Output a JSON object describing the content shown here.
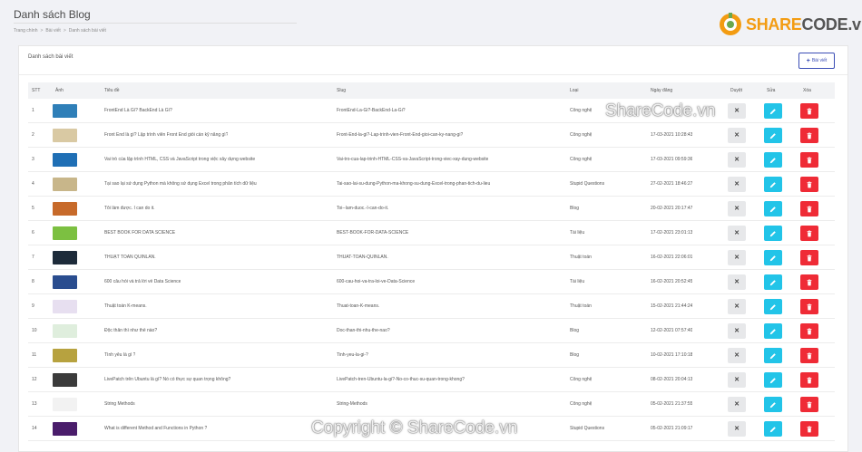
{
  "header": {
    "title": "Danh sách Blog"
  },
  "breadcrumb": [
    "Trang chính",
    "Bài viết",
    "Danh sách bài viết"
  ],
  "logo": {
    "part1": "SHARE",
    "part2": "CODE.vn"
  },
  "card": {
    "title": "Danh sách bài viết",
    "add_label": "Bài viết"
  },
  "table": {
    "headers": {
      "stt": "STT",
      "image": "Ảnh",
      "title": "Tiêu đề",
      "slug": "Slug",
      "type": "Loại",
      "date": "Ngày đăng",
      "approve": "Duyệt",
      "edit": "Sửa",
      "delete": "Xóa"
    },
    "rows": [
      {
        "stt": "1",
        "title": "FrontEnd Là Gì? BackEnd Là Gì?",
        "slug": "FrontEnd-La-Gi?-BackEnd-La-Gi?",
        "type": "Công nghệ",
        "date": "",
        "thumb": "#2f7fb8"
      },
      {
        "stt": "2",
        "title": "Front End là gì? Lập trình viên Front End giỏi cần kỹ năng gì?",
        "slug": "Front-End-la-gi?-Lap-trinh-vien-Front-End-gioi-can-ky-nang-gi?",
        "type": "Công nghệ",
        "date": "17-03-2021 10:28:43",
        "thumb": "#d9c9a3"
      },
      {
        "stt": "3",
        "title": "Vai trò của lập trình HTML, CSS và JavaScript trong việc xây dựng website",
        "slug": "Vai-tro-cua-lap-trinh-HTML-CSS-va-JavaScript-trong-viec-xay-dung-website",
        "type": "Công nghệ",
        "date": "17-03-2021 09:59:36",
        "thumb": "#1f6fb5"
      },
      {
        "stt": "4",
        "title": "Tại sao lại sử dụng Python mà không sử dụng Excel trong phân tích dữ liệu",
        "slug": "Tai-sao-lai-su-dung-Python-ma-khong-su-dung-Excel-trong-phan-tich-du-lieu",
        "type": "Stupid Questions",
        "date": "27-02-2021 18:46:27",
        "thumb": "#c8b68a"
      },
      {
        "stt": "5",
        "title": "Tôi làm được. I can do it.",
        "slug": "Toi--lam-duoc.-I-can-do-it.",
        "type": "Blog",
        "date": "20-02-2021 20:17:47",
        "thumb": "#c76a2a"
      },
      {
        "stt": "6",
        "title": "BEST BOOK FOR DATA SCIENCE",
        "slug": "BEST-BOOK-FOR-DATA-SCIENCE",
        "type": "Tài liệu",
        "date": "17-02-2021 23:01:13",
        "thumb": "#7cc041"
      },
      {
        "stt": "7",
        "title": "THUẬT TOÁN QUINLAN.",
        "slug": "THUAT-TOAN-QUINLAN.",
        "type": "Thuật toán",
        "date": "16-02-2021 22:06:01",
        "thumb": "#1d2b3a"
      },
      {
        "stt": "8",
        "title": "600 câu hỏi và trả lời về Data Science",
        "slug": "600-cau-hoi-va-tra-loi-ve-Data-Science",
        "type": "Tài liệu",
        "date": "16-02-2021 20:52:45",
        "thumb": "#2a4d8f"
      },
      {
        "stt": "9",
        "title": "Thuật toán K-means.",
        "slug": "Thuat-toan-K-means.",
        "type": "Thuật toán",
        "date": "15-02-2021 21:44:24",
        "thumb": "#e7dff0"
      },
      {
        "stt": "10",
        "title": "Độc thân thì như thế nào?",
        "slug": "Doc-than-thi-nhu-the-nao?",
        "type": "Blog",
        "date": "12-02-2021 07:57:40",
        "thumb": "#dfeedd"
      },
      {
        "stt": "11",
        "title": "Tình yêu là gì ?",
        "slug": "Tinh-yeu-la-gi-?",
        "type": "Blog",
        "date": "10-02-2021 17:10:18",
        "thumb": "#b7a23f"
      },
      {
        "stt": "12",
        "title": "LivePatch trên Ubuntu là gì? Nó có thực sự quan trọng không?",
        "slug": "LivePatch-tren-Ubuntu-la-gi?-No-co-thuc-su-quan-trong-khong?",
        "type": "Công nghệ",
        "date": "08-02-2021 20:04:13",
        "thumb": "#3b3b3b"
      },
      {
        "stt": "13",
        "title": "String Methods",
        "slug": "String-Methods",
        "type": "Công nghệ",
        "date": "05-02-2021 21:37:55",
        "thumb": "#f2f2f2"
      },
      {
        "stt": "14",
        "title": "What is different Method and Functions in Python ?",
        "slug": "",
        "type": "Stupid Questions",
        "date": "05-02-2021 21:09:17",
        "thumb": "#4a1d6b"
      }
    ]
  },
  "watermarks": {
    "top": "ShareCode.vn",
    "bottom": "Copyright © ShareCode.vn"
  },
  "colors": {
    "edit": "#22c4e8",
    "delete": "#ef2b36",
    "approve": "#e7e8ea",
    "accent": "#3a4db5",
    "logo_orange": "#f39c12"
  },
  "icons": {
    "approve": "x-icon",
    "edit": "pencil-icon",
    "delete": "trash-icon",
    "add": "plus-icon"
  }
}
